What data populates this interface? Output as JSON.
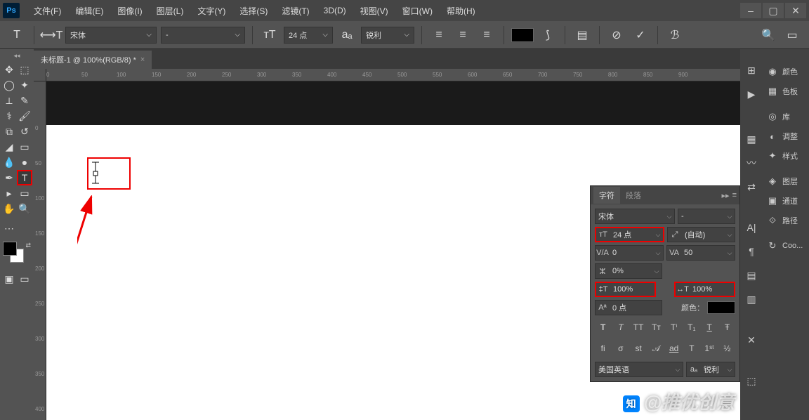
{
  "menubar": {
    "items": [
      "文件(F)",
      "编辑(E)",
      "图像(I)",
      "图层(L)",
      "文字(Y)",
      "选择(S)",
      "滤镜(T)",
      "3D(D)",
      "视图(V)",
      "窗口(W)",
      "帮助(H)"
    ]
  },
  "optbar": {
    "font_family": "宋体",
    "font_style": "-",
    "font_size": "24 点",
    "antialias": "锐利"
  },
  "doctab": {
    "title": "未标题-1 @ 100%(RGB/8) *"
  },
  "ruler_h": [
    "0",
    "50",
    "100",
    "150",
    "200",
    "250",
    "300",
    "350",
    "400",
    "450",
    "500",
    "550",
    "600",
    "650",
    "700",
    "750",
    "800",
    "850",
    "900"
  ],
  "ruler_v": [
    "0",
    "50",
    "100",
    "150",
    "200",
    "250",
    "300",
    "350",
    "400"
  ],
  "charpanel": {
    "tab1": "字符",
    "tab2": "段落",
    "font_family": "宋体",
    "font_style": "-",
    "font_size": "24 点",
    "leading": "(自动)",
    "kerning": "0",
    "tracking": "50",
    "scale_pct": "0%",
    "vscale": "100%",
    "hscale": "100%",
    "baseline": "0 点",
    "color_label": "颜色：",
    "lang": "美国英语",
    "aa": "锐利"
  },
  "panels": {
    "color": "颜色",
    "swatches": "色板",
    "library": "库",
    "adjust": "调整",
    "styles": "样式",
    "layers": "图层",
    "channels": "通道",
    "paths": "路径",
    "coo": "Coo..."
  },
  "watermark": "@推优创意"
}
